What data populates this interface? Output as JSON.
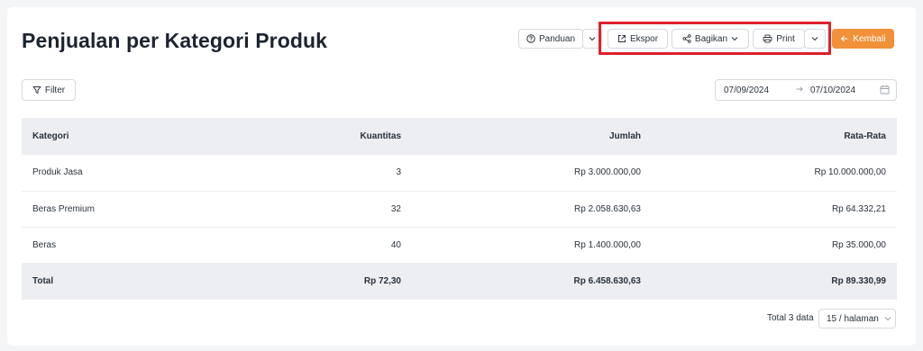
{
  "page": {
    "title": "Penjualan per Kategori Produk"
  },
  "toolbar": {
    "guide_label": "Panduan",
    "export_label": "Ekspor",
    "share_label": "Bagikan",
    "print_label": "Print",
    "back_label": "Kembali"
  },
  "filter": {
    "label": "Filter",
    "date_from": "07/09/2024",
    "date_to": "07/10/2024"
  },
  "table": {
    "headers": [
      "Kategori",
      "Kuantitas",
      "Jumlah",
      "Rata-Rata"
    ],
    "rows": [
      [
        "Produk Jasa",
        "3",
        "Rp 3.000.000,00",
        "Rp 10.000.000,00"
      ],
      [
        "Beras Premium",
        "32",
        "Rp 2.058.630,63",
        "Rp 64.332,21"
      ],
      [
        "Beras",
        "40",
        "Rp 1.400.000,00",
        "Rp 35.000,00"
      ]
    ],
    "total": [
      "Total",
      "Rp 72,30",
      "Rp 6.458.630,63",
      "Rp 89.330,99"
    ]
  },
  "pagination": {
    "total_text": "Total 3 data",
    "page_size": "15 / halaman"
  },
  "colors": {
    "accent": "#f1913a",
    "highlight_border": "#e0202a",
    "table_header_bg": "#eceef1"
  },
  "icons": {
    "guide": "question-circle-icon",
    "export": "external-link-icon",
    "share": "share-icon",
    "print": "printer-icon",
    "back": "arrow-left-icon",
    "filter": "filter-funnel-icon",
    "calendar": "calendar-icon",
    "range_arrow": "arrow-right-icon",
    "dropdown": "chevron-down-icon"
  }
}
